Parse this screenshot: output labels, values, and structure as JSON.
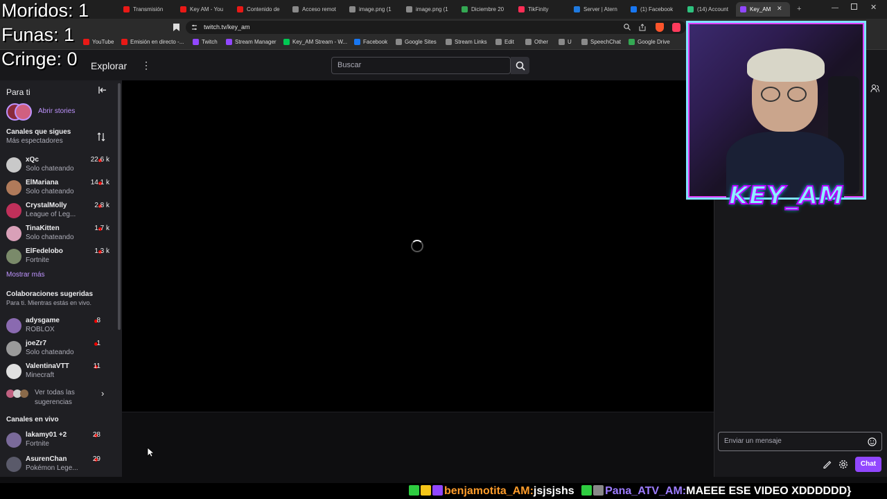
{
  "stats": {
    "muertes": "Moridos: 1",
    "funas": "Funas: 1",
    "cringe": "Cringe: 0"
  },
  "browser": {
    "tabs": [
      {
        "label": "Transmisión",
        "color": "#e91916"
      },
      {
        "label": "Key AM - You",
        "color": "#e91916"
      },
      {
        "label": "Contenido de",
        "color": "#e91916"
      },
      {
        "label": "Acceso remot",
        "color": "#8a8a8a"
      },
      {
        "label": "image.png (1",
        "color": "#8a8a8a"
      },
      {
        "label": "image.png (1",
        "color": "#8a8a8a"
      },
      {
        "label": "Diciembre 20",
        "color": "#34a853"
      },
      {
        "label": "TikFinity",
        "color": "#ff2d55"
      },
      {
        "label": "Server | Atern",
        "color": "#1f7ae0"
      },
      {
        "label": "(1) Facebook",
        "color": "#1877f2"
      },
      {
        "label": "(14) Account",
        "color": "#2ec27e"
      },
      {
        "label": "Key_AM",
        "color": "#9147ff"
      }
    ],
    "url": "twitch.tv/key_am",
    "bookmarks": [
      {
        "label": "YouTube",
        "color": "#e91916"
      },
      {
        "label": "Emisión en directo -...",
        "color": "#e91916"
      },
      {
        "label": "Twitch",
        "color": "#9147ff"
      },
      {
        "label": "Stream Manager",
        "color": "#9147ff"
      },
      {
        "label": "Key_AM Stream - W...",
        "color": "#00c853"
      },
      {
        "label": "Facebook",
        "color": "#1877f2"
      },
      {
        "label": "Google Sites",
        "color": "#8a8a8a"
      },
      {
        "label": "Stream Links",
        "color": "#8a8a8a"
      },
      {
        "label": "Edit",
        "color": "#8a8a8a"
      },
      {
        "label": "Other",
        "color": "#8a8a8a"
      },
      {
        "label": "U",
        "color": "#8a8a8a"
      },
      {
        "label": "SpeechChat",
        "color": "#8a8a8a"
      },
      {
        "label": "Google Drive",
        "color": "#34a853"
      }
    ]
  },
  "nav": {
    "explore": "Explorar",
    "more": "⋮",
    "search_placeholder": "Buscar"
  },
  "sidebar": {
    "title": "Para ti",
    "stories": "Abrir stories",
    "followed_title": "Canales que sigues",
    "followed_sort": "Más espectadores",
    "followed": [
      {
        "name": "xQc",
        "game": "Solo chateando",
        "viewers": "22.6 k",
        "color": "#c9c9c9"
      },
      {
        "name": "ElMariana",
        "game": "Solo chateando",
        "viewers": "14.1 k",
        "color": "#b07a5a"
      },
      {
        "name": "CrystalMolly",
        "game": "League of Leg...",
        "viewers": "2.8 k",
        "color": "#c0305a"
      },
      {
        "name": "TinaKitten",
        "game": "Solo chateando",
        "viewers": "1.7 k",
        "color": "#d9a0b8"
      },
      {
        "name": "ElFedelobo",
        "game": "Fortnite",
        "viewers": "1.3 k",
        "color": "#7a8a6a"
      }
    ],
    "show_more": "Mostrar más",
    "collab_title": "Colaboraciones sugeridas",
    "collab_sub": "Para ti. Mientras estás en vivo.",
    "collab": [
      {
        "name": "adysgame",
        "game": "ROBLOX",
        "viewers": "8",
        "color": "#8a6ab0"
      },
      {
        "name": "joeZr7",
        "game": "Solo chateando",
        "viewers": "1",
        "color": "#9a9a9a"
      },
      {
        "name": "ValentinaVTT",
        "game": "Minecraft",
        "viewers": "11",
        "color": "#e0e0e0"
      }
    ],
    "see_all": "Ver todas las sugerencias",
    "live_title": "Canales en vivo",
    "live": [
      {
        "name": "lakamy01 +2",
        "game": "Fortnite",
        "viewers": "28",
        "color": "#7a6a9a"
      },
      {
        "name": "AsurenChan",
        "game": "Pokémon Lege...",
        "viewers": "29",
        "color": "#5a5a6a"
      }
    ]
  },
  "chat": {
    "placeholder": "Enviar un mensaje",
    "send": "Chat"
  },
  "overlay": {
    "logo": "KEY_AM"
  },
  "ticker": {
    "msg1_user": "benjamotita_AM:",
    "msg1_text": "jsjsjshs",
    "msg2_user": "Pana_ATV_AM:",
    "msg2_text": "MAEEE ESE VIDEO XDDDDDD}"
  },
  "colors": {
    "accent": "#9147ff",
    "live": "#eb0400",
    "user1": "#ff9c2a",
    "user2": "#9d7cff"
  }
}
